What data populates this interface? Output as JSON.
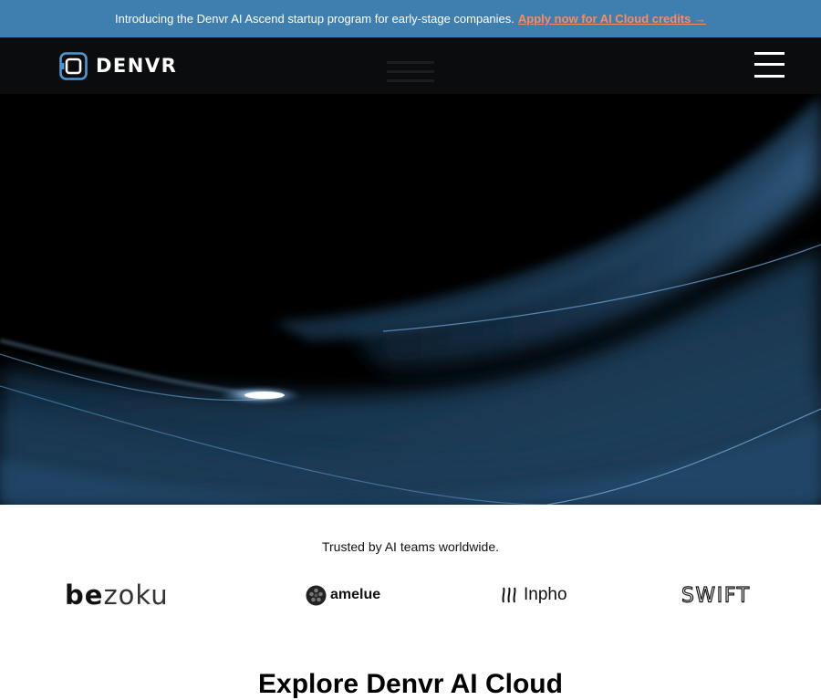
{
  "announcement": {
    "text": "Introducing the Denvr AI Ascend startup program for early-stage companies.",
    "cta": "Apply now for AI Cloud credits →"
  },
  "nav": {
    "logo_text": "DENVR",
    "logo_icon": "denvr-logo-icon",
    "menu_icon": "hamburger-menu-icon"
  },
  "trusted": {
    "title": "Trusted by AI teams worldwide.",
    "logos": {
      "bezoku": {
        "left": "be",
        "right": "zoku"
      },
      "amelue": {
        "name": "amelue",
        "icon": "amelue-globe-icon"
      },
      "inpho": {
        "name": "Inpho",
        "icon": "inpho-bars-icon"
      },
      "swift": {
        "name": "SWIFT"
      }
    }
  },
  "explore": {
    "title": "Explore Denvr AI Cloud"
  },
  "colors": {
    "banner_bg": "#3f7faf",
    "cta": "#ff8a5c",
    "nav_bg": "#0b0c0e",
    "hero_bg": "#000000",
    "hero_accent": "#4a8ac4"
  }
}
